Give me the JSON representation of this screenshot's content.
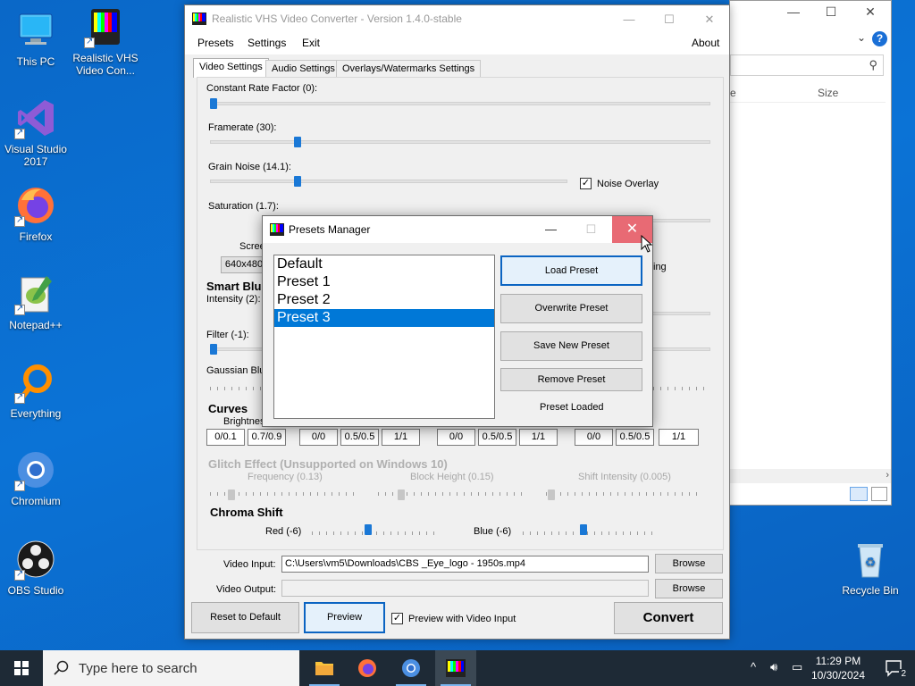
{
  "desktop": {
    "icons": [
      {
        "label": "This PC"
      },
      {
        "label": "Realistic VHS Video Con..."
      },
      {
        "label": "Visual Studio 2017"
      },
      {
        "label": "Firefox"
      },
      {
        "label": "Notepad++"
      },
      {
        "label": "Everything"
      },
      {
        "label": "Chromium"
      },
      {
        "label": "OBS Studio"
      },
      {
        "label": "Recycle Bin"
      }
    ]
  },
  "explorer": {
    "col_name_partial": "e",
    "col_size": "Size",
    "help": "?"
  },
  "app": {
    "title": "Realistic VHS Video Converter - Version 1.4.0-stable",
    "menu": {
      "presets": "Presets",
      "settings": "Settings",
      "exit": "Exit",
      "about": "About"
    },
    "tabs": [
      {
        "label": "Video Settings",
        "active": true
      },
      {
        "label": "Audio Settings",
        "active": false
      },
      {
        "label": "Overlays/Watermarks Settings",
        "active": false
      }
    ],
    "video": {
      "crf_label": "Constant Rate Factor (0):",
      "crf_level": 0.0,
      "framerate_label": "Framerate (30):",
      "framerate_level": 0.17,
      "grain_label": "Grain Noise (14.1):",
      "grain_level": 0.24,
      "noise_overlay_label": "Noise Overlay",
      "noise_overlay_checked": true,
      "saturation_label": "Saturation (1.7):",
      "screen_label_partial": "Scree",
      "resolution_partial": "640x480",
      "right_label_partial": "ing",
      "smart_blur_partial": "Smart Blu",
      "intensity_partial": "Intensity (2):",
      "filter_label": "Filter (-1):",
      "filter_level": 0.0,
      "gaussian_partial": "Gaussian Blur",
      "curves_title": "Curves",
      "brightness_partial": "Brightnes",
      "curves_values": [
        "0/0.1",
        "0.7/0.9",
        "0/0",
        "0.5/0.5",
        "1/1",
        "0/0",
        "0.5/0.5",
        "1/1",
        "0/0",
        "0.5/0.5",
        "1/1"
      ],
      "glitch_title": "Glitch Effect (Unsupported on Windows 10)",
      "glitch_frequency": "Frequency (0.13)",
      "glitch_block_height": "Block Height (0.15)",
      "glitch_shift": "Shift Intensity (0.005)",
      "chroma_title": "Chroma Shift",
      "chroma_red": "Red (-6)",
      "chroma_red_level": 0.45,
      "chroma_blue": "Blue (-6)",
      "chroma_blue_level": 0.45
    },
    "io": {
      "input_label": "Video Input:",
      "input_value": "C:\\Users\\vm5\\Downloads\\CBS _Eye_logo - 1950s.mp4",
      "output_label": "Video Output:",
      "output_value": "",
      "browse": "Browse"
    },
    "bottom": {
      "reset": "Reset to Default",
      "preview": "Preview",
      "preview_with_input": "Preview with Video Input",
      "preview_with_input_checked": true,
      "convert": "Convert"
    }
  },
  "presets_dialog": {
    "title": "Presets Manager",
    "items": [
      "Default",
      "Preset 1",
      "Preset 2",
      "Preset 3"
    ],
    "selected": "Preset 3",
    "load": "Load Preset",
    "overwrite": "Overwrite Preset",
    "save_new": "Save New Preset",
    "remove": "Remove Preset",
    "status": "Preset Loaded"
  },
  "taskbar": {
    "search_placeholder": "Type here to search",
    "time": "11:29 PM",
    "date": "10/30/2024",
    "notifications": "2"
  },
  "colors": {
    "accent": "#0078d7",
    "desktop": "#0b6fd0",
    "close_hover": "#e86a74"
  }
}
